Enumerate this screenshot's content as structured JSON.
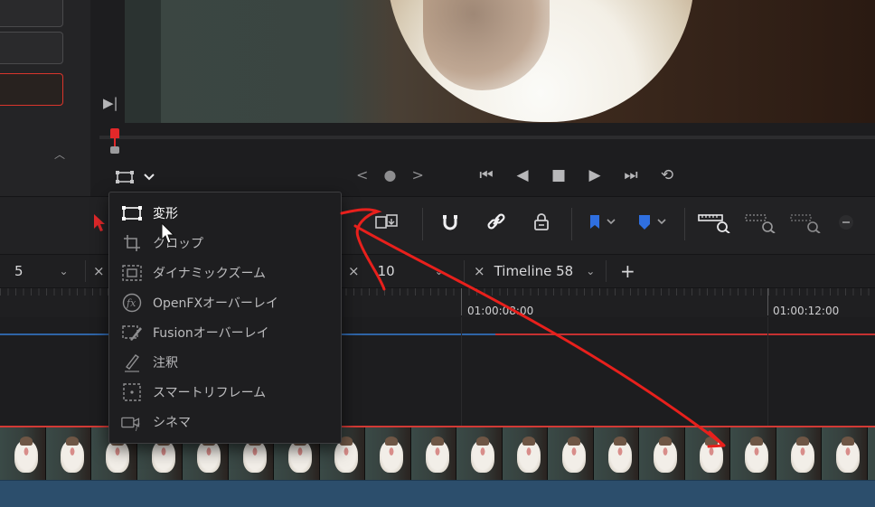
{
  "viewer": {
    "nav_arrows": "< ● >",
    "transport": [
      {
        "name": "go-to-start",
        "glyph": "⏮"
      },
      {
        "name": "play-reverse",
        "glyph": "◀"
      },
      {
        "name": "stop",
        "glyph": "■"
      },
      {
        "name": "play",
        "glyph": "▶"
      },
      {
        "name": "go-to-end",
        "glyph": "⏭"
      },
      {
        "name": "loop",
        "glyph": "⟲"
      }
    ],
    "overlay_chevron": "⌄"
  },
  "overlay_menu": {
    "items": [
      {
        "label": "変形",
        "icon": "transform-icon",
        "state": "active"
      },
      {
        "label": "クロップ",
        "icon": "crop-icon",
        "state": "normal"
      },
      {
        "label": "ダイナミックズーム",
        "icon": "dynamic-zoom-icon",
        "state": "normal"
      },
      {
        "label": "OpenFXオーバーレイ",
        "icon": "openfx-icon",
        "state": "normal"
      },
      {
        "label": "Fusionオーバーレイ",
        "icon": "fusion-icon",
        "state": "normal"
      },
      {
        "label": "注釈",
        "icon": "annotation-pen-icon",
        "state": "normal"
      },
      {
        "label": "スマートリフレーム",
        "icon": "smart-reframe-icon",
        "state": "normal"
      },
      {
        "label": "シネマ",
        "icon": "cinema-icon",
        "state": "normal"
      }
    ]
  },
  "tabs": [
    {
      "label": "5"
    },
    {
      "label": "10"
    },
    {
      "label": "Timeline 58"
    }
  ],
  "tabs_add": "+",
  "timeline": {
    "timecodes": [
      "01:00:08:00",
      "01:00:12:00"
    ]
  },
  "colors": {
    "accent_red": "#e2282a",
    "playhead": "#e2282a",
    "flag_blue": "#2f6fe0",
    "audio_track": "#2c4e6c",
    "annotation": "#e8201c"
  }
}
